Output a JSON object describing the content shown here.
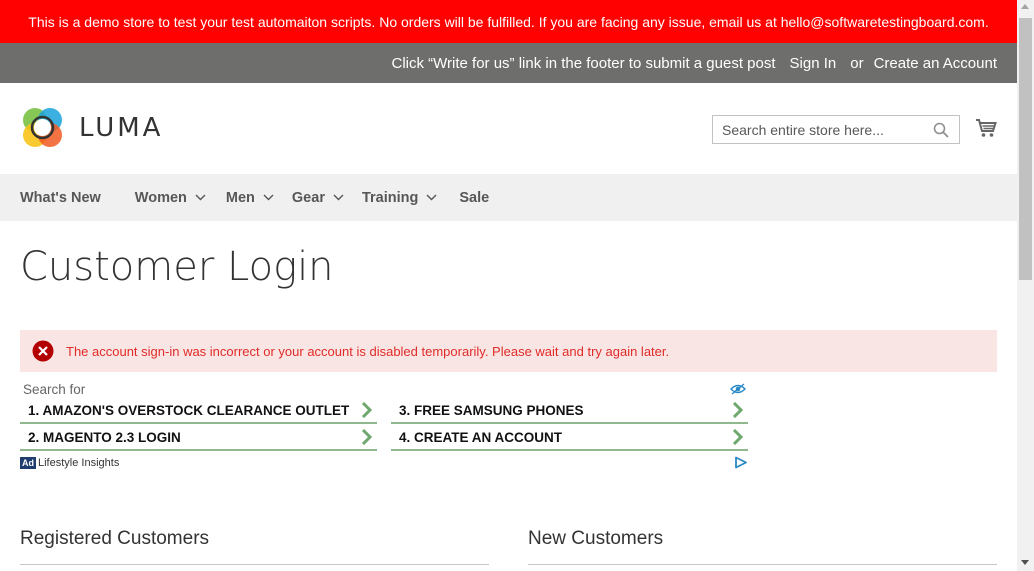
{
  "demo_notice": "This is a demo store to test your test automaiton scripts. No orders will be fulfilled. If you are facing any issue, email us at hello@softwaretestingboard.com.",
  "top_bar": {
    "promo": "Click “Write for us” link in the footer to submit a guest post",
    "sign_in": "Sign In",
    "or": "or",
    "create_account": "Create an Account"
  },
  "logo": {
    "text": "LUMA"
  },
  "search": {
    "placeholder": "Search entire store here..."
  },
  "nav": {
    "items": [
      {
        "label": "What's New",
        "has_dropdown": false
      },
      {
        "label": "Women",
        "has_dropdown": true
      },
      {
        "label": "Men",
        "has_dropdown": true
      },
      {
        "label": "Gear",
        "has_dropdown": true
      },
      {
        "label": "Training",
        "has_dropdown": true
      },
      {
        "label": "Sale",
        "has_dropdown": false
      }
    ]
  },
  "page": {
    "title": "Customer Login"
  },
  "error": {
    "message": "The account sign-in was incorrect or your account is disabled temporarily. Please wait and try again later."
  },
  "ads": {
    "label": "Search for",
    "links": [
      "1. AMAZON'S OVERSTOCK CLEARANCE OUTLET",
      "2. MAGENTO 2.3 LOGIN",
      "3. FREE SAMSUNG PHONES",
      "4. CREATE AN ACCOUNT"
    ],
    "badge": "Ad",
    "sponsor": "Lifestyle Insights"
  },
  "sections": {
    "registered": "Registered Customers",
    "new": "New Customers"
  },
  "colors": {
    "demo_bar": "#ff0101",
    "top_bar": "#6e6e6d",
    "nav_bg": "#f0f0f0",
    "error_bg": "#fae5e5",
    "error_text": "#e02b27"
  }
}
